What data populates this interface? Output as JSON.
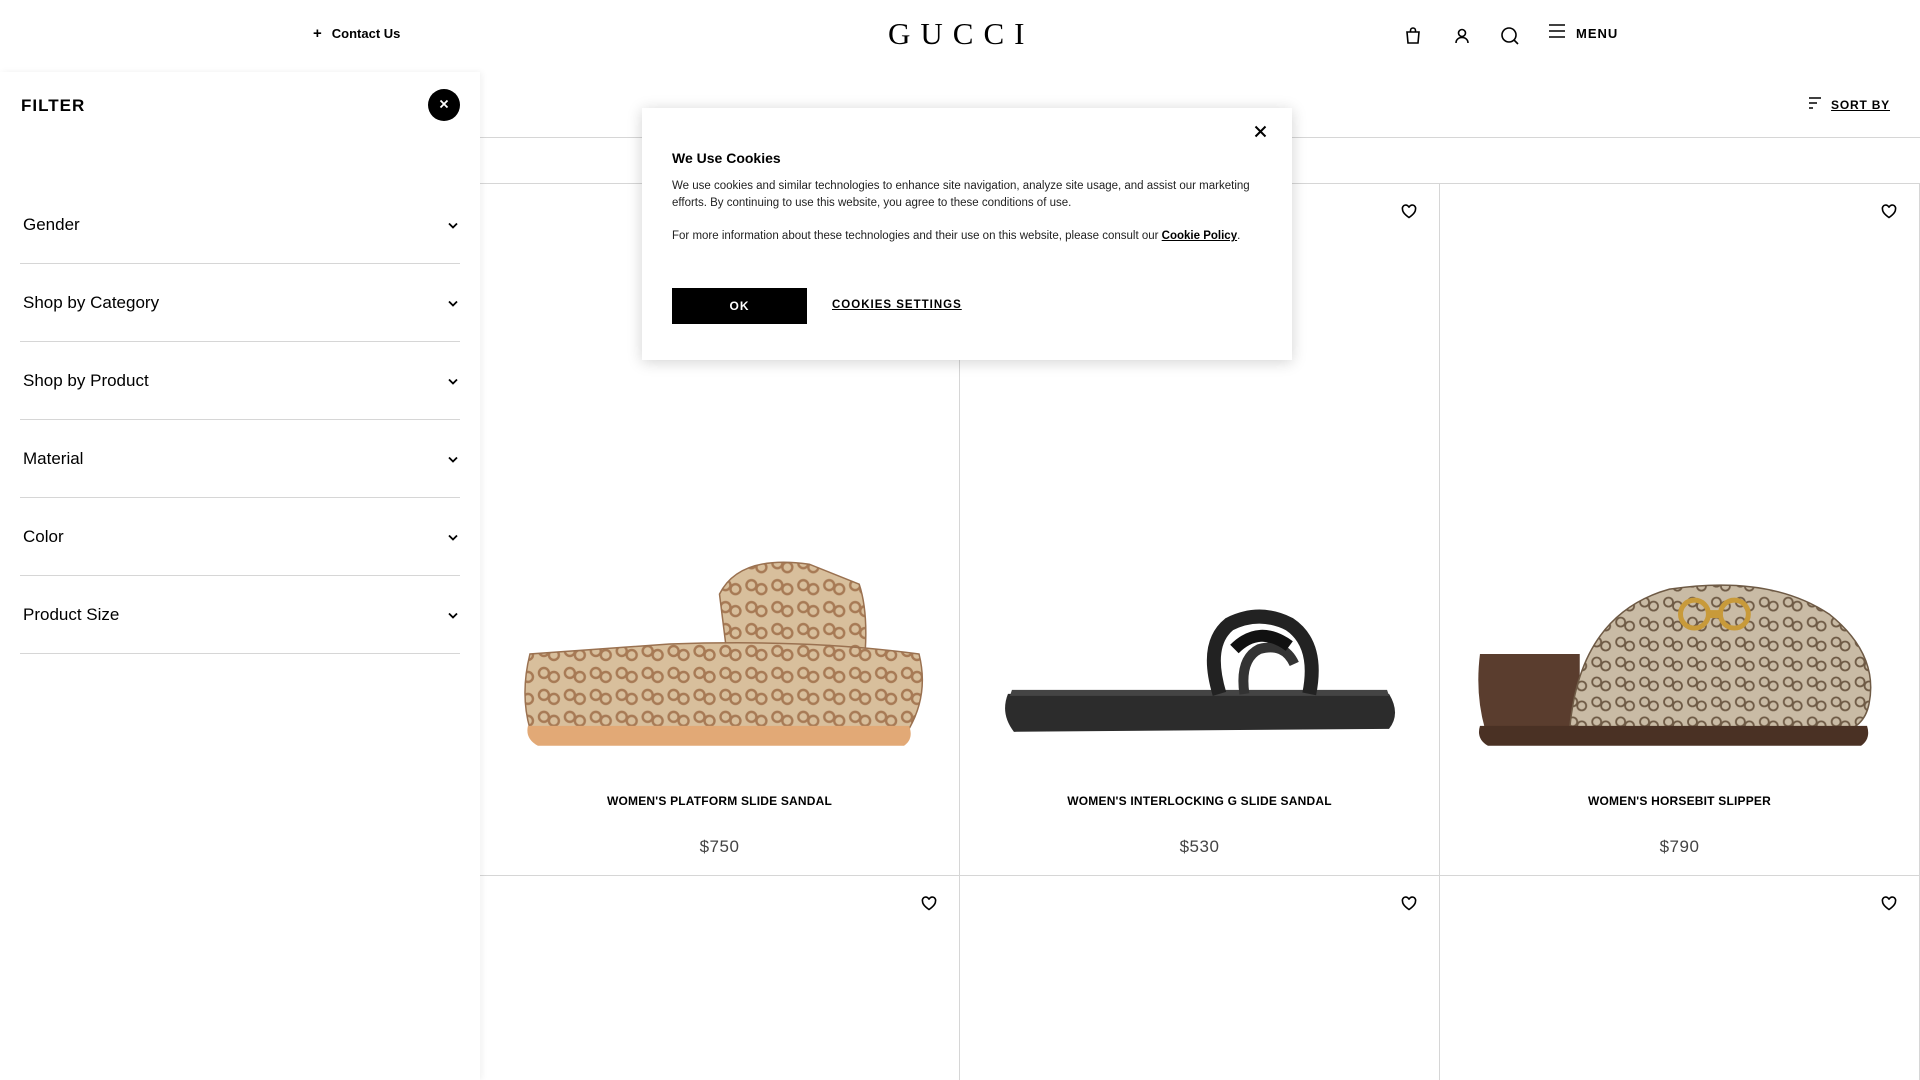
{
  "header": {
    "contact_label": "Contact Us",
    "logo_text": "GUCCI",
    "menu_label": "MENU",
    "icons": [
      "shopping-bag-icon",
      "user-icon",
      "search-icon",
      "hamburger-menu-icon"
    ]
  },
  "toolbar": {
    "sort_label": "SORT BY"
  },
  "filter": {
    "title": "FILTER",
    "facets": [
      {
        "label": "Gender"
      },
      {
        "label": "Shop by Category"
      },
      {
        "label": "Shop by Product"
      },
      {
        "label": "Material"
      },
      {
        "label": "Color"
      },
      {
        "label": "Product Size"
      }
    ]
  },
  "products": [
    {
      "name": "WOMEN'S PLATFORM SLIDE SANDAL",
      "price": "$750"
    },
    {
      "name": "WOMEN'S INTERLOCKING G SLIDE SANDAL",
      "price": "$530"
    },
    {
      "name": "WOMEN'S HORSEBIT SLIPPER",
      "price": "$790"
    }
  ],
  "cookie_dialog": {
    "title": "We Use Cookies",
    "paragraph1": "We use cookies and similar technologies to enhance site navigation, analyze site usage, and assist our marketing efforts. By continuing to use this website, you agree to these conditions of use.",
    "paragraph2_prefix": "For more information about these technologies and their use on this website, please consult our ",
    "policy_link": "Cookie Policy",
    "paragraph2_suffix": ".",
    "ok_label": "OK",
    "settings_label": "COOKIES SETTINGS"
  },
  "colors": {
    "accent": "#000000",
    "divider": "#d6d6d6",
    "price": "#444444"
  }
}
